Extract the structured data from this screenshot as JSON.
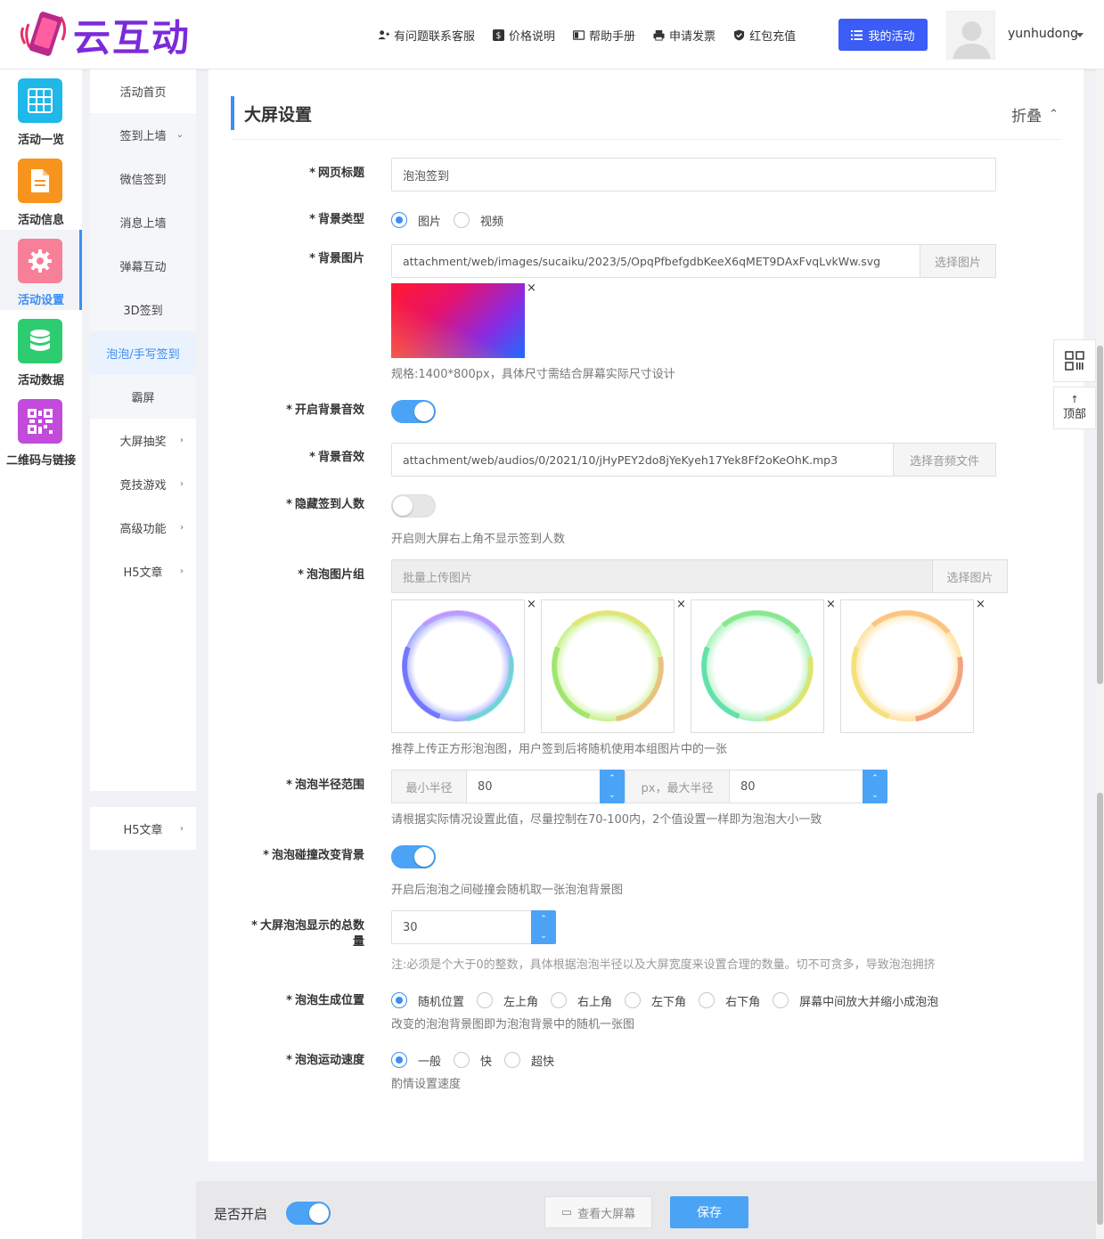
{
  "brand": {
    "name": "云互动"
  },
  "topnav": {
    "items": [
      {
        "label": "有问题联系客服",
        "icon": "user-plus-icon"
      },
      {
        "label": "价格说明",
        "icon": "dollar-icon"
      },
      {
        "label": "帮助手册",
        "icon": "book-icon"
      },
      {
        "label": "申请发票",
        "icon": "printer-icon"
      },
      {
        "label": "红包充值",
        "icon": "shield-check-icon"
      }
    ],
    "my_activity": "我的活动",
    "username": "yunhudong"
  },
  "iconbar": {
    "items": [
      {
        "label": "活动一览",
        "icon": "grid-icon",
        "color": "#1fb8e8"
      },
      {
        "label": "活动信息",
        "icon": "document-icon",
        "color": "#f7941d"
      },
      {
        "label": "活动设置",
        "icon": "gear-icon",
        "color": "#f77f98"
      },
      {
        "label": "活动数据",
        "icon": "database-icon",
        "color": "#2ecc71"
      },
      {
        "label": "二维码与链接",
        "icon": "qrcode-icon",
        "color": "#c24bdb"
      }
    ]
  },
  "subnav": {
    "items": [
      {
        "label": "活动首页"
      },
      {
        "label": "签到上墙",
        "chev": "⌄"
      },
      {
        "label": "微信签到"
      },
      {
        "label": "消息上墙"
      },
      {
        "label": "弹幕互动"
      },
      {
        "label": "3D签到"
      },
      {
        "label": "泡泡/手写签到"
      },
      {
        "label": "霸屏"
      },
      {
        "label": "大屏抽奖",
        "chev": "›"
      },
      {
        "label": "竞技游戏",
        "chev": "›"
      },
      {
        "label": "高级功能",
        "chev": "›"
      },
      {
        "label": "H5文章",
        "chev": "›"
      }
    ],
    "bottom": {
      "label": "H5文章",
      "chev": "›"
    }
  },
  "section": {
    "title": "大屏设置",
    "fold": "折叠",
    "fold_icon": "⌃"
  },
  "form": {
    "page_title": {
      "label": "网页标题",
      "value": "泡泡签到"
    },
    "bg_type": {
      "label": "背景类型",
      "options": [
        "图片",
        "视频"
      ],
      "selected": "图片"
    },
    "bg_image": {
      "label": "背景图片",
      "value": "attachment/web/images/sucaiku/2023/5/OpqPfbefgdbKeeX6qMET9DAxFvqLvkWw.svg",
      "button": "选择图片",
      "remove": "×",
      "hint": "规格:1400*800px，具体尺寸需结合屏幕实际尺寸设计"
    },
    "bg_music_on": {
      "label": "开启背景音效",
      "on": true
    },
    "bg_music": {
      "label": "背景音效",
      "value": "attachment/web/audios/0/2021/10/jHyPEY2do8jYeKyeh17Yek8Ff2oKeOhK.mp3",
      "button": "选择音频文件"
    },
    "hide_count": {
      "label": "隐藏签到人数",
      "on": false,
      "hint": "开启则大屏右上角不显示签到人数"
    },
    "bubble_images": {
      "label": "泡泡图片组",
      "placeholder": "批量上传图片",
      "button": "选择图片",
      "remove": "×",
      "hint": "推荐上传正方形泡泡图，用户签到后将随机使用本组图片中的一张"
    },
    "radius": {
      "label": "泡泡半径范围",
      "min_label": "最小半径",
      "min_value": "80",
      "mid_label": "px，最大半径",
      "max_value": "80",
      "hint": "请根据实际情况设置此值，尽量控制在70-100内，2个值设置一样即为泡泡大小一致"
    },
    "collision": {
      "label": "泡泡碰撞改变背景",
      "on": true,
      "hint": "开启后泡泡之间碰撞会随机取一张泡泡背景图"
    },
    "total": {
      "label_line1": "大屏泡泡显示的总数",
      "label_line2": "量",
      "value": "30",
      "hint": "注:必须是个大于0的整数，具体根据泡泡半径以及大屏宽度来设置合理的数量。切不可贪多，导致泡泡拥挤"
    },
    "position": {
      "label": "泡泡生成位置",
      "options": [
        "随机位置",
        "左上角",
        "右上角",
        "左下角",
        "右下角",
        "屏幕中间放大并缩小成泡泡"
      ],
      "selected": "随机位置",
      "hint": "改变的泡泡背景图即为泡泡背景中的随机一张图"
    },
    "speed": {
      "label": "泡泡运动速度",
      "options": [
        "一般",
        "快",
        "超快"
      ],
      "selected": "一般",
      "hint": "酌情设置速度"
    }
  },
  "floattools": {
    "qr_icon": "qrcode-icon",
    "top_arrow": "↑",
    "top_label": "顶部"
  },
  "footer": {
    "enable_label": "是否开启",
    "enable_on": true,
    "view_button": "查看大屏幕",
    "view_icon": "▭",
    "save_button": "保存"
  },
  "req": "*",
  "spin_up": "⌃",
  "spin_down": "⌄"
}
